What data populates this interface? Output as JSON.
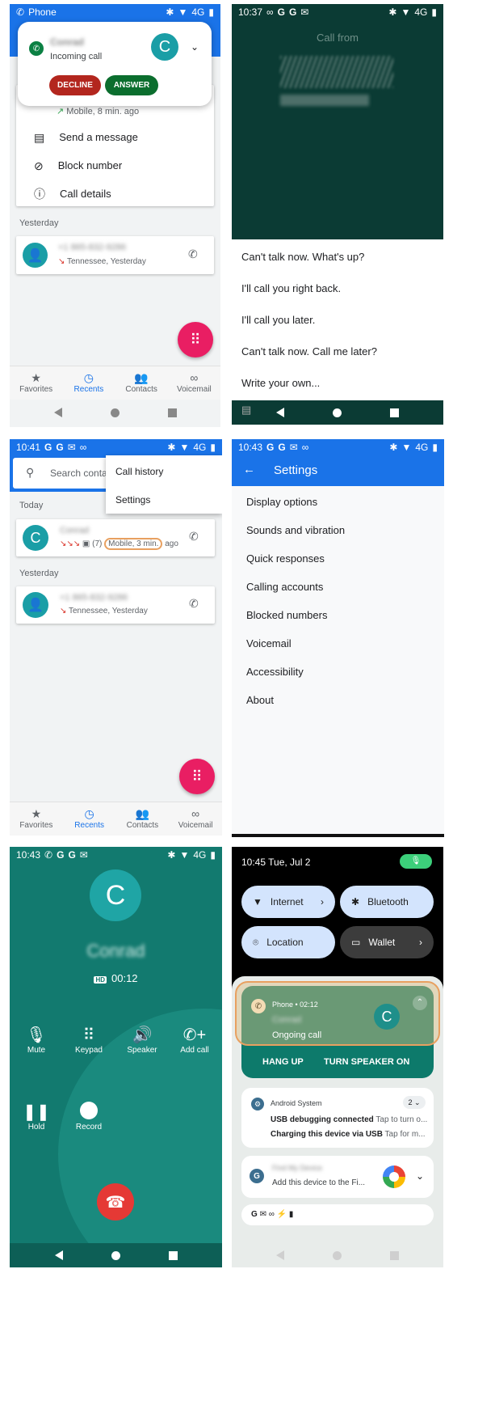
{
  "panel1": {
    "status_left": "Phone",
    "status_right": "4G",
    "notif": {
      "caller": "Conrad",
      "subtitle": "Incoming call",
      "avatar_letter": "C",
      "decline": "DECLINE",
      "answer": "ANSWER"
    },
    "entry_meta": "Mobile, 8 min. ago",
    "menu": [
      "Send a message",
      "Block number",
      "Call details"
    ],
    "yesterday_header": "Yesterday",
    "yesterday_number": "+1 865-832-9286",
    "yesterday_meta": "Tennessee, Yesterday",
    "tabs": [
      "Favorites",
      "Recents",
      "Contacts",
      "Voicemail"
    ]
  },
  "panel2": {
    "time": "10:37",
    "status_right": "4G",
    "call_from": "Call from",
    "replies": [
      "Can't talk now. What's up?",
      "I'll call you right back.",
      "I'll call you later.",
      "Can't talk now. Call me later?",
      "Write your own..."
    ]
  },
  "panel3": {
    "time": "10:41",
    "status_right": "4G",
    "search_placeholder": "Search conta",
    "menu": [
      "Call history",
      "Settings"
    ],
    "today_header": "Today",
    "today_name": "Conrad",
    "today_meta_prefix": "(7)",
    "today_meta_highlight": "Mobile, 3 min.",
    "today_meta_suffix": "ago",
    "avatar_letter": "C",
    "yesterday_header": "Yesterday",
    "yesterday_number": "+1 865-832-9286",
    "yesterday_meta": "Tennessee, Yesterday",
    "tabs": [
      "Favorites",
      "Recents",
      "Contacts",
      "Voicemail"
    ]
  },
  "panel4": {
    "time": "10:43",
    "status_right": "4G",
    "title": "Settings",
    "items": [
      "Display options",
      "Sounds and vibration",
      "Quick responses",
      "Calling accounts",
      "Blocked numbers",
      "Voicemail",
      "Accessibility",
      "About"
    ]
  },
  "panel5": {
    "time": "10:43",
    "status_right": "4G",
    "avatar_letter": "C",
    "caller": "Conrad",
    "hd": "HD",
    "duration": "00:12",
    "buttons": [
      "Mute",
      "Keypad",
      "Speaker",
      "Add call",
      "Hold",
      "Record"
    ]
  },
  "panel6": {
    "datetime": "10:45 Tue, Jul 2",
    "tiles": [
      "Internet",
      "Bluetooth",
      "Location",
      "Wallet"
    ],
    "call_notif": {
      "app": "Phone • 02:12",
      "caller": "Conrad",
      "status": "Ongoing call",
      "avatar_letter": "C",
      "hang_up": "HANG UP",
      "speaker": "TURN SPEAKER ON"
    },
    "system": {
      "app": "Android System",
      "count": "2",
      "line1_bold": "USB debugging connected",
      "line1_rest": "Tap to turn o...",
      "line2_bold": "Charging this device via USB",
      "line2_rest": "Tap for m..."
    },
    "google": {
      "title": "Find My Device",
      "body": "Add this device to the Fi..."
    }
  }
}
